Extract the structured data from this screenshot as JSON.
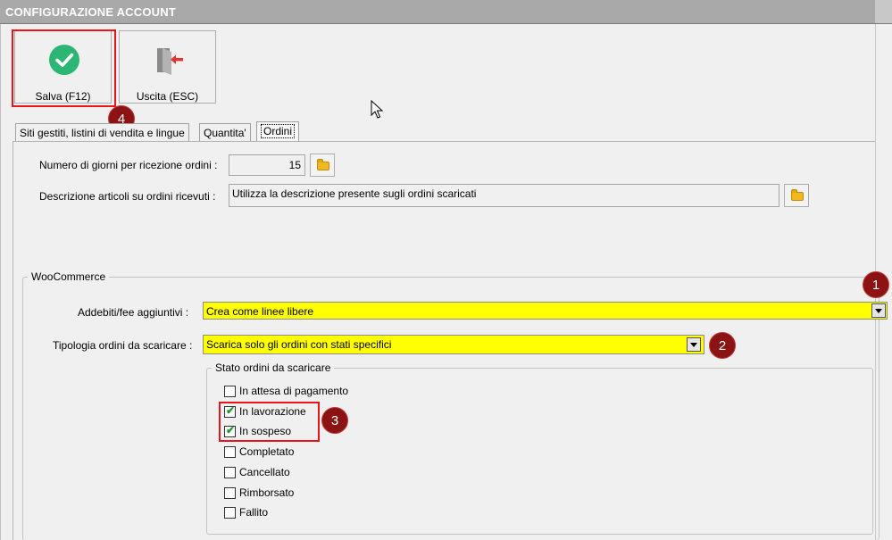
{
  "window": {
    "title": "CONFIGURAZIONE ACCOUNT"
  },
  "toolbar": {
    "save_label": "Salva (F12)",
    "exit_label": "Uscita (ESC)",
    "save_icon": "check-circle-icon",
    "exit_icon": "exit-door-icon"
  },
  "tabs": [
    {
      "label": "Siti gestiti, listini di vendita e lingue",
      "selected": false
    },
    {
      "label": "Quantita'",
      "selected": false
    },
    {
      "label": "Ordini",
      "selected": true
    }
  ],
  "orders": {
    "days_label": "Numero di giorni per ricezione ordini :",
    "days_value": "15",
    "desc_label": "Descrizione articoli su ordini ricevuti :",
    "desc_value": "Utilizza la descrizione presente sugli ordini scaricati"
  },
  "woocommerce": {
    "group_title": "WooCommerce",
    "fees_label": "Addebiti/fee aggiuntivi :",
    "fees_value": "Crea come linee libere",
    "type_label": "Tipologia ordini da scaricare :",
    "type_value": "Scarica solo gli ordini con stati specifici",
    "status_group_title": "Stato ordini da scaricare",
    "statuses": [
      {
        "label": "In attesa di pagamento",
        "checked": false
      },
      {
        "label": "In lavorazione",
        "checked": true
      },
      {
        "label": "In sospeso",
        "checked": true
      },
      {
        "label": "Completato",
        "checked": false
      },
      {
        "label": "Cancellato",
        "checked": false
      },
      {
        "label": "Rimborsato",
        "checked": false
      },
      {
        "label": "Fallito",
        "checked": false
      }
    ]
  },
  "callouts": [
    "1",
    "2",
    "3",
    "4"
  ],
  "colors": {
    "highlight": "#ffff00",
    "callout": "#8b1313",
    "annotation_box": "#e8161c",
    "check": "#1a9a2a"
  }
}
